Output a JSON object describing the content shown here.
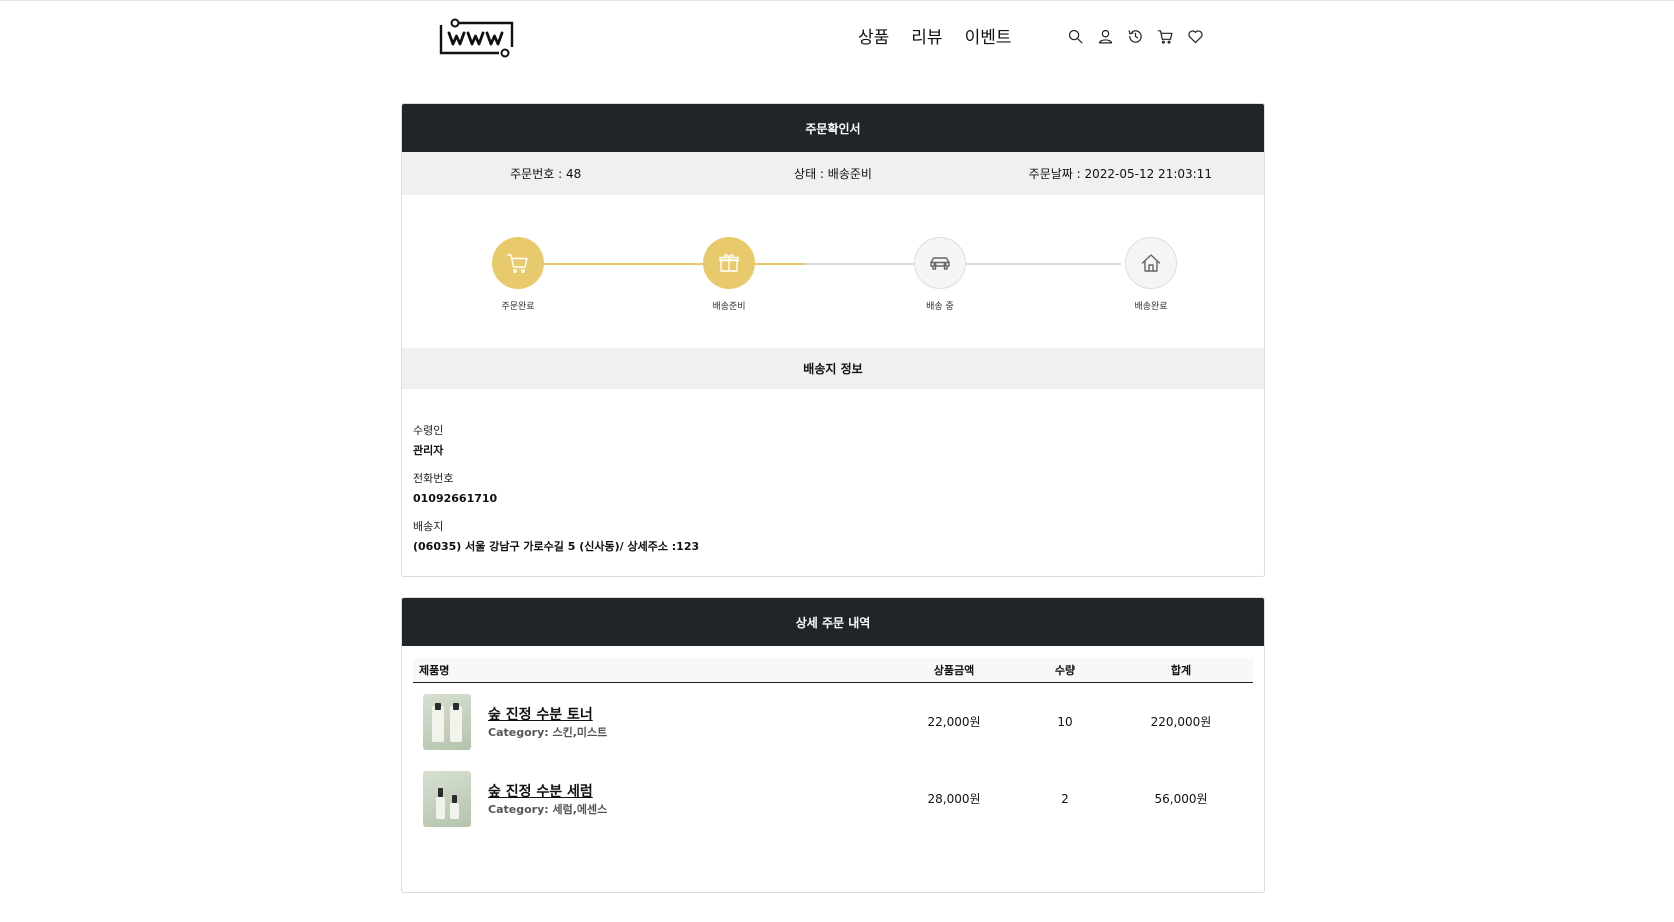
{
  "header": {
    "nav": [
      "상품",
      "리뷰",
      "이벤트"
    ],
    "icons": [
      "search-icon",
      "user-icon",
      "history-icon",
      "cart-icon",
      "heart-icon"
    ]
  },
  "order": {
    "title": "주문확인서",
    "number": "주문번호 : 48",
    "status": "상태 : 배송준비",
    "date": "주문날짜 : 2022-05-12 21:03:11",
    "accent_color": "#e8c96b",
    "steps": [
      {
        "label": "주문완료",
        "icon": "cart-icon",
        "done": true
      },
      {
        "label": "배송준비",
        "icon": "gift-icon",
        "done": true
      },
      {
        "label": "배송 중",
        "icon": "car-icon",
        "done": false
      },
      {
        "label": "배송완료",
        "icon": "home-icon",
        "done": false
      }
    ]
  },
  "shipping": {
    "title": "배송지 정보",
    "recipient_label": "수령인",
    "recipient": "관리자",
    "phone_label": "전화번호",
    "phone": "01092661710",
    "address_label": "배송지",
    "address": "(06035) 서울 강남구 가로수길 5 (신사동)/ 상세주소 :123"
  },
  "details": {
    "title": "상세 주문 내역",
    "columns": [
      "제품명",
      "상품금액",
      "수량",
      "합계"
    ],
    "items": [
      {
        "name": "숲 진정 수분 토너",
        "category": "Category: 스킨,미스트",
        "price": "22,000원",
        "qty": "10",
        "total": "220,000원"
      },
      {
        "name": "숲 진정 수분 세럼",
        "category": "Category: 세럼,에센스",
        "price": "28,000원",
        "qty": "2",
        "total": "56,000원"
      }
    ]
  }
}
